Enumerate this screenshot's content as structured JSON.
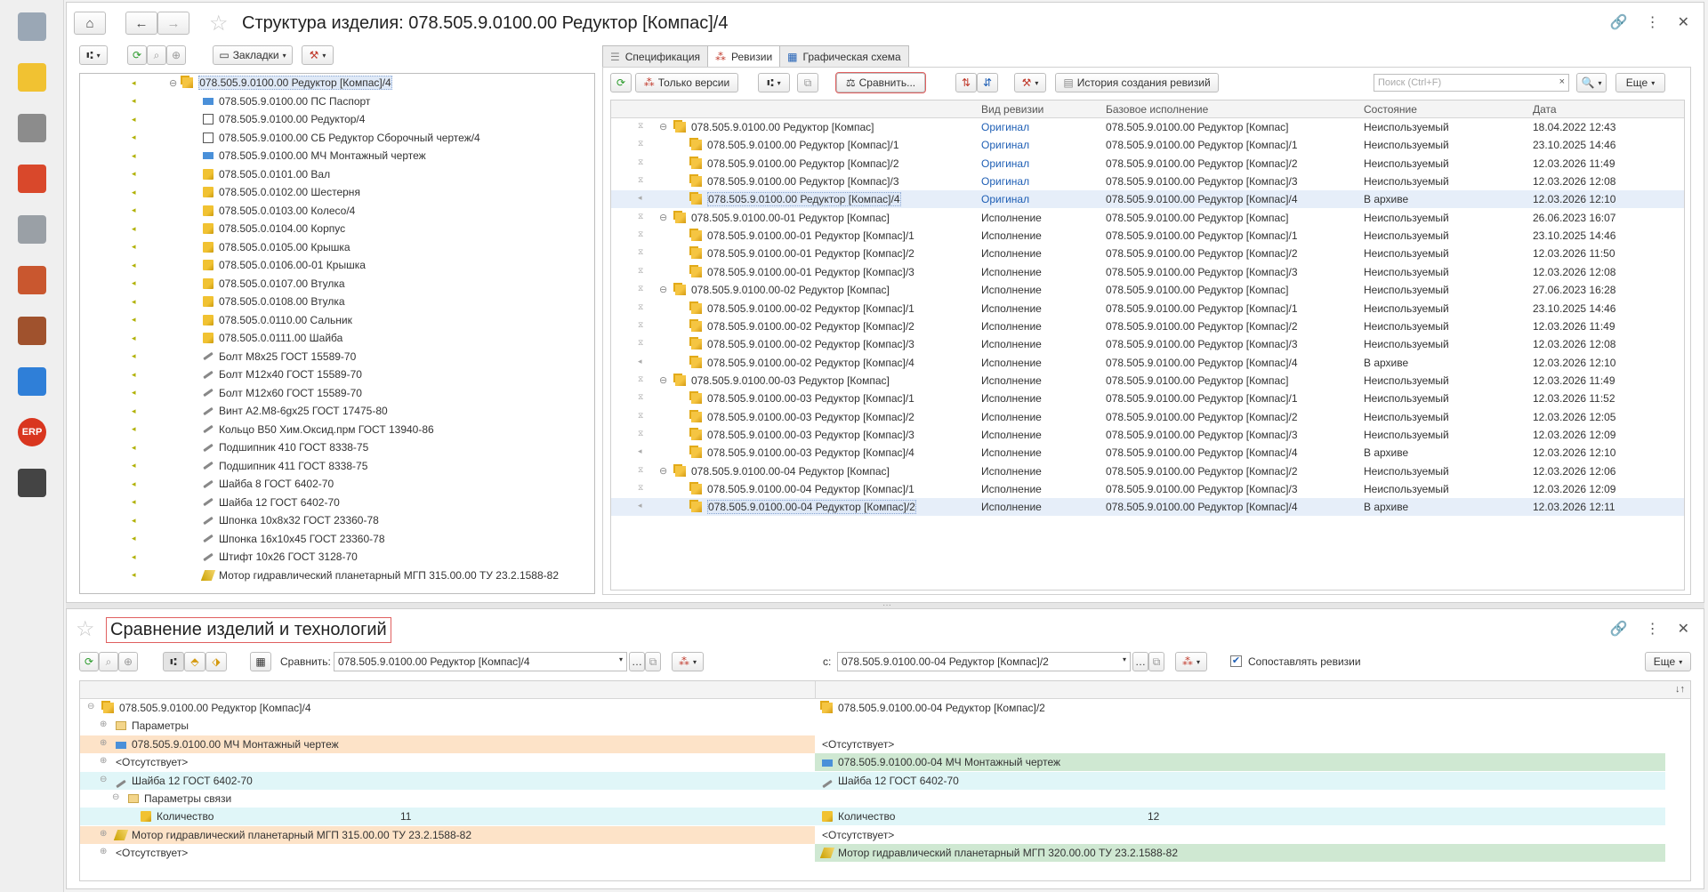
{
  "top": {
    "title": "Структура изделия: 078.505.9.0100.00 Редуктор [Компас]/4",
    "bookmarks_label": "Закладки"
  },
  "tree": [
    {
      "text": "078.505.9.0100.00 Редуктор [Компас]/4",
      "icon": "assembly-icon",
      "level": 0
    },
    {
      "text": "078.505.9.0100.00 ПС Паспорт",
      "icon": "document-blue-icon",
      "level": 1
    },
    {
      "text": "078.505.9.0100.00 Редуктор/4",
      "icon": "drawing-icon",
      "level": 1
    },
    {
      "text": "078.505.9.0100.00 СБ Редуктор Сборочный чертеж/4",
      "icon": "drawing-icon",
      "level": 1
    },
    {
      "text": "078.505.9.0100.00 МЧ Монтажный чертеж",
      "icon": "document-blue-icon",
      "level": 1
    },
    {
      "text": "078.505.0.0101.00 Вал",
      "icon": "part-icon",
      "level": 1
    },
    {
      "text": "078.505.0.0102.00 Шестерня",
      "icon": "part-icon",
      "level": 1
    },
    {
      "text": "078.505.0.0103.00 Колесо/4",
      "icon": "part-icon",
      "level": 1
    },
    {
      "text": "078.505.0.0104.00 Корпус",
      "icon": "part-icon",
      "level": 1
    },
    {
      "text": "078.505.0.0105.00 Крышка",
      "icon": "part-icon",
      "level": 1
    },
    {
      "text": "078.505.0.0106.00-01 Крышка",
      "icon": "part-icon",
      "level": 1
    },
    {
      "text": "078.505.0.0107.00 Втулка",
      "icon": "part-icon",
      "level": 1
    },
    {
      "text": "078.505.0.0108.00 Втулка",
      "icon": "part-icon",
      "level": 1
    },
    {
      "text": "078.505.0.0110.00 Сальник",
      "icon": "part-icon",
      "level": 1
    },
    {
      "text": "078.505.0.0111.00 Шайба",
      "icon": "part-icon",
      "level": 1
    },
    {
      "text": "Болт М8х25 ГОСТ 15589-70",
      "icon": "standard-part-icon",
      "level": 1
    },
    {
      "text": "Болт М12х40 ГОСТ 15589-70",
      "icon": "standard-part-icon",
      "level": 1
    },
    {
      "text": "Болт М12х60 ГОСТ 15589-70",
      "icon": "standard-part-icon",
      "level": 1
    },
    {
      "text": "Винт А2.М8-6gх25 ГОСТ 17475-80",
      "icon": "standard-part-icon",
      "level": 1
    },
    {
      "text": "Кольцо В50 Хим.Оксид.прм ГОСТ 13940-86",
      "icon": "standard-part-icon",
      "level": 1
    },
    {
      "text": "Подшипник 410  ГОСТ 8338-75",
      "icon": "standard-part-icon",
      "level": 1
    },
    {
      "text": "Подшипник 411 ГОСТ 8338-75",
      "icon": "standard-part-icon",
      "level": 1
    },
    {
      "text": "Шайба 8 ГОСТ 6402-70",
      "icon": "standard-part-icon",
      "level": 1
    },
    {
      "text": "Шайба 12 ГОСТ 6402-70",
      "icon": "standard-part-icon",
      "level": 1
    },
    {
      "text": "Шпонка 10х8х32 ГОСТ 23360-78",
      "icon": "standard-part-icon",
      "level": 1
    },
    {
      "text": "Шпонка 16х10х45 ГОСТ 23360-78",
      "icon": "standard-part-icon",
      "level": 1
    },
    {
      "text": "Штифт 10х26 ГОСТ 3128-70",
      "icon": "standard-part-icon",
      "level": 1
    },
    {
      "text": "Мотор гидравлический планетарный МГП 315.00.00 ТУ 23.2.1588-82",
      "icon": "other-icon",
      "level": 1
    }
  ],
  "tabs": [
    {
      "label": "Спецификация",
      "active": false
    },
    {
      "label": "Ревизии",
      "active": true
    },
    {
      "label": "Графическая схема",
      "active": false
    }
  ],
  "rev_toolbar": {
    "only_versions": "Только версии",
    "compare": "Сравнить...",
    "history": "История создания ревизий",
    "search_placeholder": "Поиск (Ctrl+F)",
    "more": "Еще"
  },
  "rev_columns": {
    "type": "Вид ревизии",
    "base": "Базовое исполнение",
    "state": "Состояние",
    "date": "Дата"
  },
  "revisions": [
    {
      "name": "078.505.9.0100.00 Редуктор [Компас]",
      "type": "Оригинал",
      "base": "078.505.9.0100.00 Редуктор [Компас]",
      "state": "Неиспользуемый",
      "date": "18.04.2022 12:43",
      "level": 0,
      "group": true
    },
    {
      "name": "078.505.9.0100.00 Редуктор [Компас]/1",
      "type": "Оригинал",
      "base": "078.505.9.0100.00 Редуктор [Компас]/1",
      "state": "Неиспользуемый",
      "date": "23.10.2025 14:46",
      "level": 1
    },
    {
      "name": "078.505.9.0100.00 Редуктор [Компас]/2",
      "type": "Оригинал",
      "base": "078.505.9.0100.00 Редуктор [Компас]/2",
      "state": "Неиспользуемый",
      "date": "12.03.2026 11:49",
      "level": 1
    },
    {
      "name": "078.505.9.0100.00 Редуктор [Компас]/3",
      "type": "Оригинал",
      "base": "078.505.9.0100.00 Редуктор [Компас]/3",
      "state": "Неиспользуемый",
      "date": "12.03.2026 12:08",
      "level": 1
    },
    {
      "name": "078.505.9.0100.00 Редуктор [Компас]/4",
      "type": "Оригинал",
      "base": "078.505.9.0100.00 Редуктор [Компас]/4",
      "state": "В архиве",
      "date": "12.03.2026 12:10",
      "level": 1,
      "selected": true
    },
    {
      "name": "078.505.9.0100.00-01 Редуктор [Компас]",
      "type": "Исполнение",
      "base": "078.505.9.0100.00 Редуктор [Компас]",
      "state": "Неиспользуемый",
      "date": "26.06.2023 16:07",
      "level": 0,
      "group": true
    },
    {
      "name": "078.505.9.0100.00-01 Редуктор [Компас]/1",
      "type": "Исполнение",
      "base": "078.505.9.0100.00 Редуктор [Компас]/1",
      "state": "Неиспользуемый",
      "date": "23.10.2025 14:46",
      "level": 1
    },
    {
      "name": "078.505.9.0100.00-01 Редуктор [Компас]/2",
      "type": "Исполнение",
      "base": "078.505.9.0100.00 Редуктор [Компас]/2",
      "state": "Неиспользуемый",
      "date": "12.03.2026 11:50",
      "level": 1
    },
    {
      "name": "078.505.9.0100.00-01 Редуктор [Компас]/3",
      "type": "Исполнение",
      "base": "078.505.9.0100.00 Редуктор [Компас]/3",
      "state": "Неиспользуемый",
      "date": "12.03.2026 12:08",
      "level": 1
    },
    {
      "name": "078.505.9.0100.00-02 Редуктор [Компас]",
      "type": "Исполнение",
      "base": "078.505.9.0100.00 Редуктор [Компас]",
      "state": "Неиспользуемый",
      "date": "27.06.2023 16:28",
      "level": 0,
      "group": true
    },
    {
      "name": "078.505.9.0100.00-02 Редуктор [Компас]/1",
      "type": "Исполнение",
      "base": "078.505.9.0100.00 Редуктор [Компас]/1",
      "state": "Неиспользуемый",
      "date": "23.10.2025 14:46",
      "level": 1
    },
    {
      "name": "078.505.9.0100.00-02 Редуктор [Компас]/2",
      "type": "Исполнение",
      "base": "078.505.9.0100.00 Редуктор [Компас]/2",
      "state": "Неиспользуемый",
      "date": "12.03.2026 11:49",
      "level": 1
    },
    {
      "name": "078.505.9.0100.00-02 Редуктор [Компас]/3",
      "type": "Исполнение",
      "base": "078.505.9.0100.00 Редуктор [Компас]/3",
      "state": "Неиспользуемый",
      "date": "12.03.2026 12:08",
      "level": 1
    },
    {
      "name": "078.505.9.0100.00-02 Редуктор [Компас]/4",
      "type": "Исполнение",
      "base": "078.505.9.0100.00 Редуктор [Компас]/4",
      "state": "В архиве",
      "date": "12.03.2026 12:10",
      "level": 1
    },
    {
      "name": "078.505.9.0100.00-03 Редуктор [Компас]",
      "type": "Исполнение",
      "base": "078.505.9.0100.00 Редуктор [Компас]",
      "state": "Неиспользуемый",
      "date": "12.03.2026 11:49",
      "level": 0,
      "group": true
    },
    {
      "name": "078.505.9.0100.00-03 Редуктор [Компас]/1",
      "type": "Исполнение",
      "base": "078.505.9.0100.00 Редуктор [Компас]/1",
      "state": "Неиспользуемый",
      "date": "12.03.2026 11:52",
      "level": 1
    },
    {
      "name": "078.505.9.0100.00-03 Редуктор [Компас]/2",
      "type": "Исполнение",
      "base": "078.505.9.0100.00 Редуктор [Компас]/2",
      "state": "Неиспользуемый",
      "date": "12.03.2026 12:05",
      "level": 1
    },
    {
      "name": "078.505.9.0100.00-03 Редуктор [Компас]/3",
      "type": "Исполнение",
      "base": "078.505.9.0100.00 Редуктор [Компас]/3",
      "state": "Неиспользуемый",
      "date": "12.03.2026 12:09",
      "level": 1
    },
    {
      "name": "078.505.9.0100.00-03 Редуктор [Компас]/4",
      "type": "Исполнение",
      "base": "078.505.9.0100.00 Редуктор [Компас]/4",
      "state": "В архиве",
      "date": "12.03.2026 12:10",
      "level": 1
    },
    {
      "name": "078.505.9.0100.00-04 Редуктор [Компас]",
      "type": "Исполнение",
      "base": "078.505.9.0100.00 Редуктор [Компас]/2",
      "state": "Неиспользуемый",
      "date": "12.03.2026 12:06",
      "level": 0,
      "group": true
    },
    {
      "name": "078.505.9.0100.00-04 Редуктор [Компас]/1",
      "type": "Исполнение",
      "base": "078.505.9.0100.00 Редуктор [Компас]/3",
      "state": "Неиспользуемый",
      "date": "12.03.2026 12:09",
      "level": 1
    },
    {
      "name": "078.505.9.0100.00-04 Редуктор [Компас]/2",
      "type": "Исполнение",
      "base": "078.505.9.0100.00 Редуктор [Компас]/4",
      "state": "В архиве",
      "date": "12.03.2026 12:11",
      "level": 1,
      "selected": true
    }
  ],
  "compare": {
    "title": "Сравнение изделий и технологий",
    "compare_label": "Сравнить:",
    "left_value": "078.505.9.0100.00 Редуктор [Компас]/4",
    "with_label": "с:",
    "right_value": "078.505.9.0100.00-04 Редуктор [Компас]/2",
    "match_revisions_label": "Сопоставлять ревизии",
    "match_revisions_checked": true,
    "more": "Еще",
    "sort_icon_text": "↓↑",
    "rows": [
      {
        "left": "078.505.9.0100.00 Редуктор [Компас]/4",
        "right": "078.505.9.0100.00-04 Редуктор [Компас]/2",
        "indent": 0,
        "left_icon": "assembly-icon",
        "right_icon": "assembly-icon",
        "bg": "#ffffff",
        "right_bg": "#ffffff"
      },
      {
        "left": "Параметры",
        "right": "",
        "indent": 1,
        "left_icon": "folder-icon",
        "right_icon": "",
        "bg": "#ffffff",
        "right_bg": "#ffffff"
      },
      {
        "left": "078.505.9.0100.00 МЧ Монтажный чертеж",
        "right": "<Отсутствует>",
        "indent": 1,
        "left_icon": "document-blue-icon",
        "right_icon": "",
        "bg": "#fde3c8",
        "right_bg": "#ffffff"
      },
      {
        "left": "<Отсутствует>",
        "right": "078.505.9.0100.00-04 МЧ Монтажный чертеж",
        "indent": 1,
        "left_icon": "",
        "right_icon": "document-blue-icon",
        "bg": "#ffffff",
        "right_bg": "#cfe8d2"
      },
      {
        "left": "Шайба 12 ГОСТ 6402-70",
        "right": "Шайба 12 ГОСТ 6402-70",
        "indent": 1,
        "left_icon": "standard-part-icon",
        "right_icon": "standard-part-icon",
        "bg": "#e0f6f8",
        "right_bg": "#e0f6f8"
      },
      {
        "left": "Параметры связи",
        "right": "",
        "indent": 2,
        "left_icon": "folder-icon",
        "right_icon": "",
        "bg": "#ffffff",
        "right_bg": "#ffffff"
      },
      {
        "left": "Количество",
        "left_val": "11",
        "right": "Количество",
        "right_val": "12",
        "indent": 3,
        "left_icon": "parameter-icon",
        "right_icon": "parameter-icon",
        "bg": "#e0f6f8",
        "right_bg": "#e0f6f8"
      },
      {
        "left": "Мотор гидравлический планетарный МГП 315.00.00 ТУ 23.2.1588-82",
        "right": "<Отсутствует>",
        "indent": 1,
        "left_icon": "other-icon",
        "right_icon": "",
        "bg": "#fde3c8",
        "right_bg": "#ffffff"
      },
      {
        "left": "<Отсутствует>",
        "right": "Мотор гидравлический планетарный МГП 320.00.00 ТУ 23.2.1588-82",
        "indent": 1,
        "left_icon": "",
        "right_icon": "other-icon",
        "bg": "#ffffff",
        "right_bg": "#cfe8d2"
      }
    ]
  },
  "sidebar": [
    "desktop-icon",
    "catalog-icon",
    "settings-gears-icon",
    "books-icon",
    "printer-icon",
    "clipboard-icon",
    "briefcase-icon",
    "puzzle-icon",
    "erp-icon",
    "tools-icon"
  ],
  "erp_label": "ERP",
  "colors": {
    "accent": "#1f5fb5",
    "selected": "#dfe9f7",
    "removed": "#fde3c8",
    "added": "#cfe8d2",
    "changed": "#e0f6f8",
    "compare_outline": "#e06060"
  }
}
